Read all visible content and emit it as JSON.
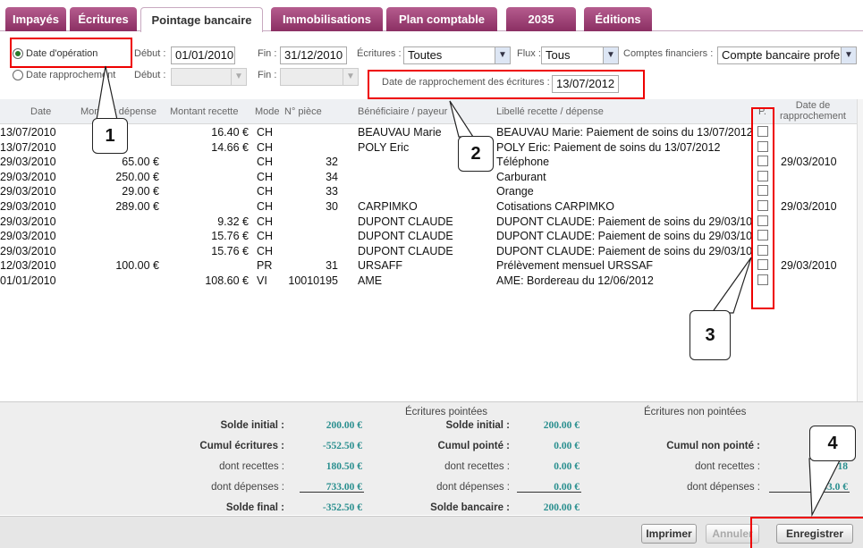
{
  "tabs": [
    "Impayés",
    "Écritures",
    "Pointage bancaire",
    "Immobilisations",
    "Plan comptable",
    "2035",
    "Éditions"
  ],
  "filters": {
    "radio_operation": "Date d'opération",
    "radio_rapprochement": "Date rapprochement",
    "debut_label": "Début :",
    "fin_label": "Fin :",
    "debut_value": "01/01/2010",
    "fin_value": "31/12/2010",
    "ecritures_label": "Écritures :",
    "ecritures_value": "Toutes",
    "flux_label": "Flux :",
    "flux_value": "Tous",
    "comptes_label": "Comptes financiers :",
    "comptes_value": "Compte bancaire profe:",
    "rapprochement_label": "Date de rapprochement des écritures :",
    "rapprochement_value": "13/07/2012"
  },
  "columns": [
    "Date",
    "Montant dépense",
    "Montant recette",
    "Mode",
    "N° pièce",
    "Bénéficiaire / payeur",
    "Libellé recette / dépense",
    "P.",
    "Date de rapprochement"
  ],
  "rows": [
    {
      "date": "13/07/2010",
      "depense": "",
      "recette": "16.40 €",
      "mode": "CH",
      "piece": "",
      "benef": "BEAUVAU Marie",
      "libelle": "BEAUVAU Marie: Paiement de soins du 13/07/2012",
      "rappro": ""
    },
    {
      "date": "13/07/2010",
      "depense": "",
      "recette": "14.66 €",
      "mode": "CH",
      "piece": "",
      "benef": "POLY Eric",
      "libelle": "POLY Eric: Paiement de soins du 13/07/2012",
      "rappro": ""
    },
    {
      "date": "29/03/2010",
      "depense": "65.00 €",
      "recette": "",
      "mode": "CH",
      "piece": "32",
      "benef": "",
      "libelle": "Téléphone",
      "rappro": "29/03/2010"
    },
    {
      "date": "29/03/2010",
      "depense": "250.00 €",
      "recette": "",
      "mode": "CH",
      "piece": "34",
      "benef": "",
      "libelle": "Carburant",
      "rappro": ""
    },
    {
      "date": "29/03/2010",
      "depense": "29.00 €",
      "recette": "",
      "mode": "CH",
      "piece": "33",
      "benef": "",
      "libelle": "Orange",
      "rappro": ""
    },
    {
      "date": "29/03/2010",
      "depense": "289.00 €",
      "recette": "",
      "mode": "CH",
      "piece": "30",
      "benef": "CARPIMKO",
      "libelle": "Cotisations CARPIMKO",
      "rappro": "29/03/2010"
    },
    {
      "date": "29/03/2010",
      "depense": "",
      "recette": "9.32 €",
      "mode": "CH",
      "piece": "",
      "benef": "DUPONT CLAUDE",
      "libelle": "DUPONT CLAUDE: Paiement de soins du 29/03/10",
      "rappro": ""
    },
    {
      "date": "29/03/2010",
      "depense": "",
      "recette": "15.76 €",
      "mode": "CH",
      "piece": "",
      "benef": "DUPONT CLAUDE",
      "libelle": "DUPONT CLAUDE: Paiement de soins du 29/03/10",
      "rappro": ""
    },
    {
      "date": "29/03/2010",
      "depense": "",
      "recette": "15.76 €",
      "mode": "CH",
      "piece": "",
      "benef": "DUPONT CLAUDE",
      "libelle": "DUPONT CLAUDE: Paiement de soins du 29/03/10",
      "rappro": ""
    },
    {
      "date": "12/03/2010",
      "depense": "100.00 €",
      "recette": "",
      "mode": "PR",
      "piece": "31",
      "benef": "URSAFF",
      "libelle": "Prélèvement mensuel URSSAF",
      "rappro": "29/03/2010"
    },
    {
      "date": "01/01/2010",
      "depense": "",
      "recette": "108.60 €",
      "mode": "VI",
      "piece": "10010195",
      "benef": "AME",
      "libelle": "AME: Bordereau du 12/06/2012",
      "rappro": ""
    }
  ],
  "summary": {
    "section_pointees": "Écritures pointées",
    "section_non_pointees": "Écritures non pointées",
    "col1": [
      {
        "label": "Solde initial :",
        "value": "200.00 €"
      },
      {
        "label": "Cumul écritures :",
        "value": "-552.50 €"
      },
      {
        "label": "dont recettes :",
        "value": "180.50 €"
      },
      {
        "label": "dont dépenses :",
        "value": "733.00 €"
      },
      {
        "label": "Solde final :",
        "value": "-352.50 €"
      }
    ],
    "col2": [
      {
        "label": "Solde initial :",
        "value": "200.00 €"
      },
      {
        "label": "Cumul pointé :",
        "value": "0.00 €"
      },
      {
        "label": "dont recettes :",
        "value": "0.00 €"
      },
      {
        "label": "dont dépenses :",
        "value": "0.00 €"
      },
      {
        "label": "Solde bancaire :",
        "value": "200.00 €"
      }
    ],
    "col3": [
      {
        "label": "Cumul non pointé :",
        "value": "-55"
      },
      {
        "label": "dont recettes :",
        "value": "18"
      },
      {
        "label": "dont dépenses :",
        "value": "733.0 €"
      }
    ]
  },
  "buttons": {
    "imprimer": "Imprimer",
    "annuler": "Annuler",
    "enregistrer": "Enregistrer"
  },
  "callouts": [
    "1",
    "2",
    "3",
    "4"
  ],
  "colors": {
    "tab_accent": "#9c3a72",
    "annotation_red": "#e00000",
    "summary_value": "#2a8f8f"
  }
}
